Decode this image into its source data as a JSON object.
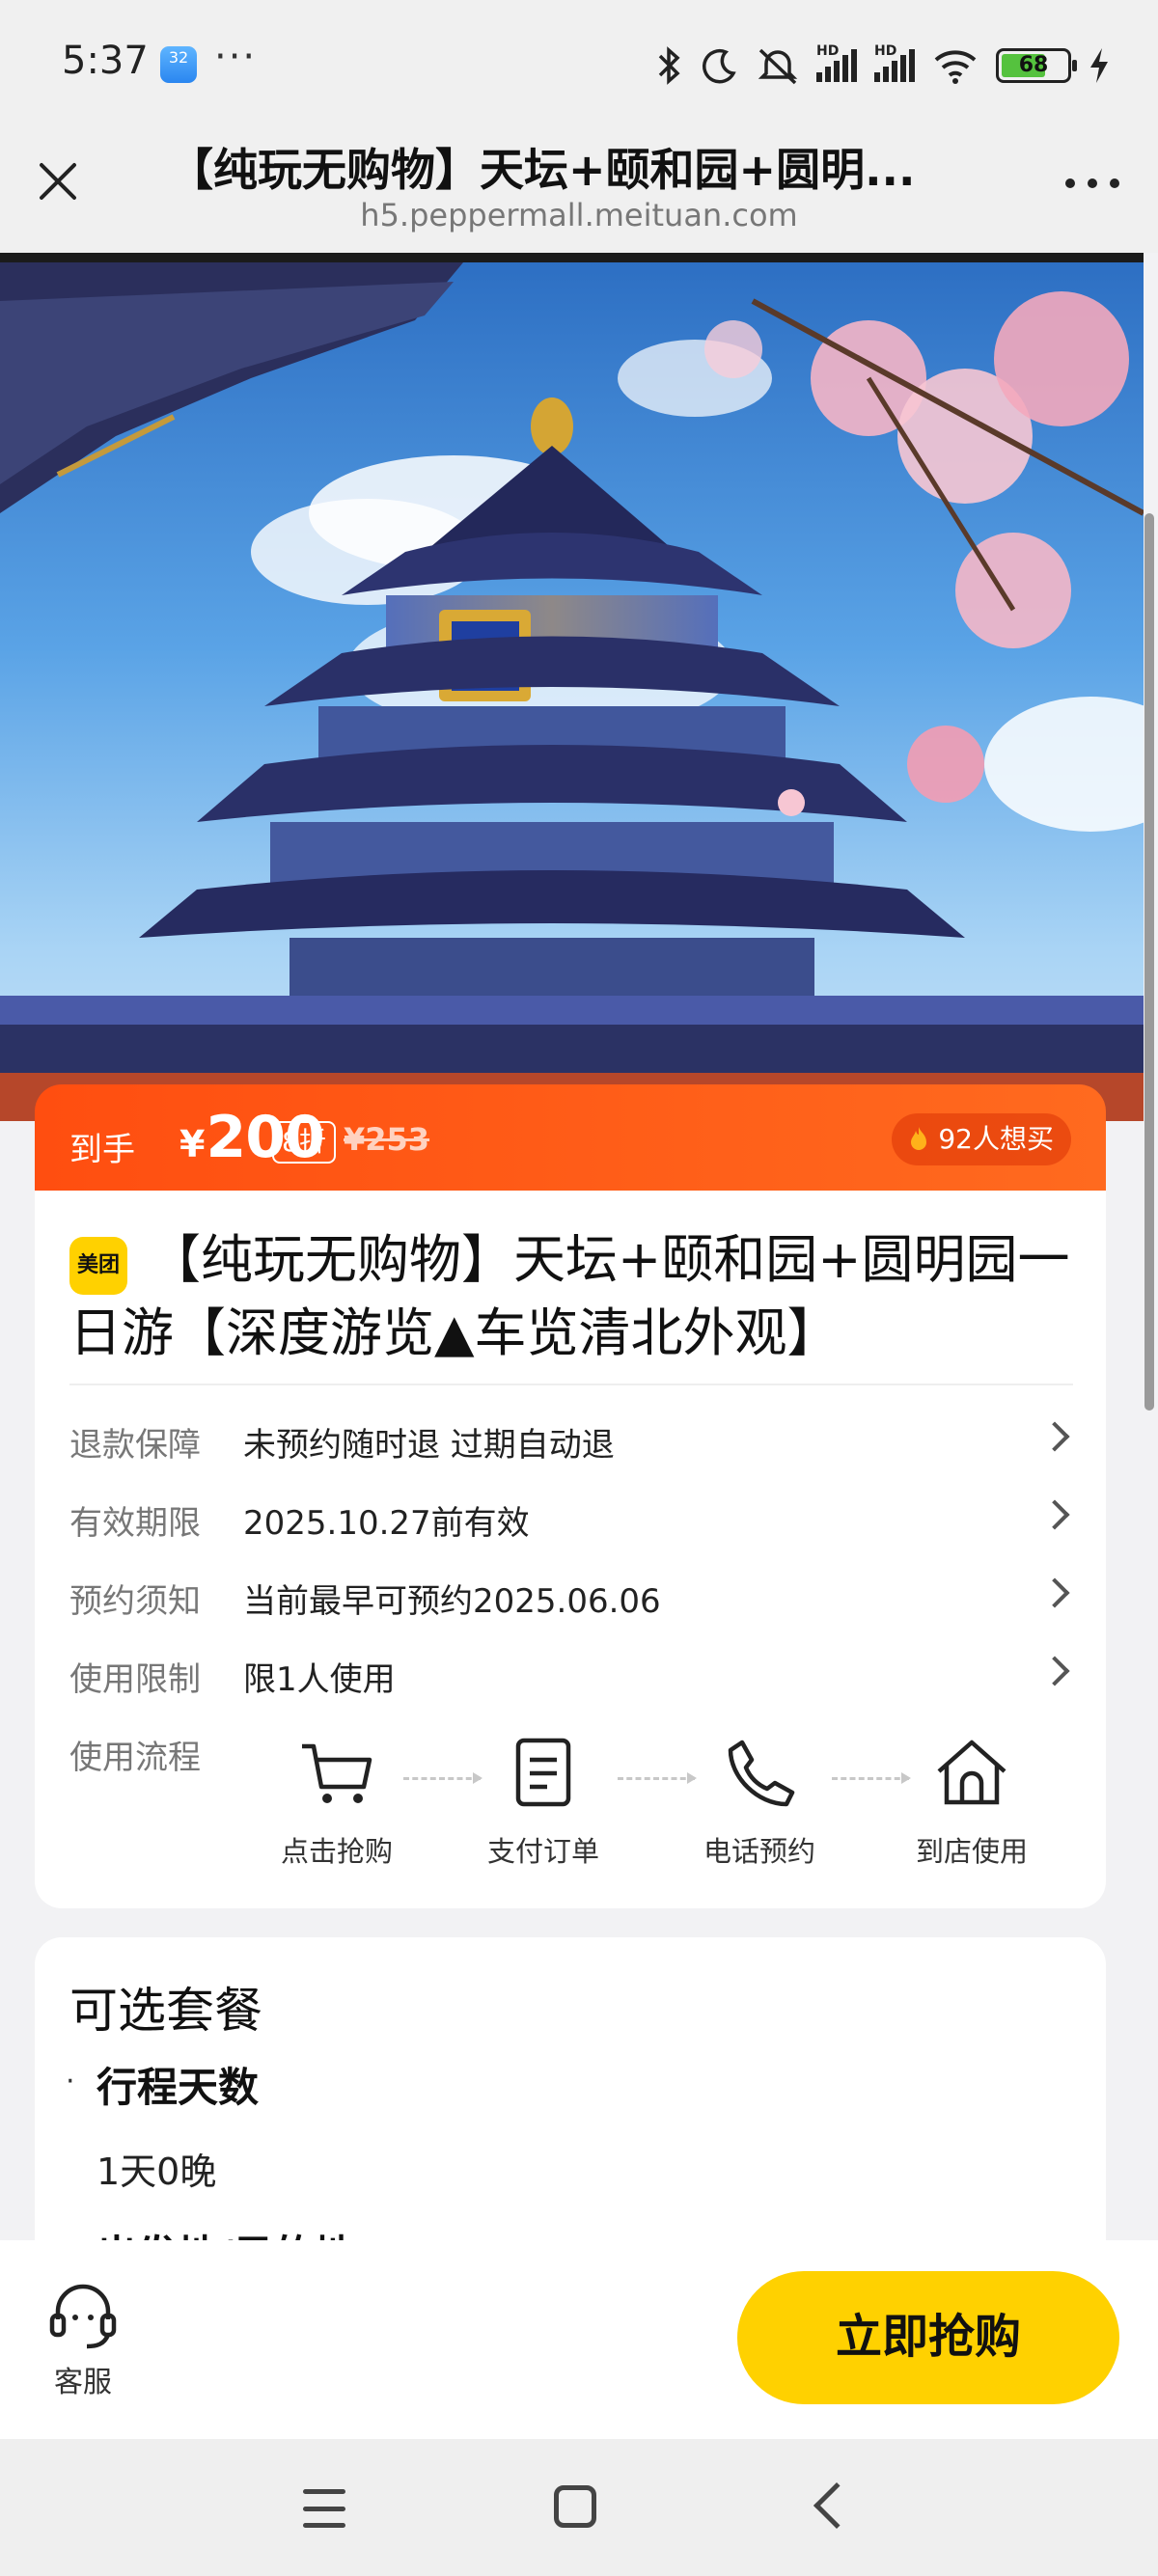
{
  "status_bar": {
    "time": "5:37",
    "app_icon_label": "32",
    "more": "···",
    "hd_label": "HD",
    "battery_level": "68",
    "icons": [
      "bluetooth-icon",
      "moon-icon",
      "mute-icon",
      "signal-icon",
      "signal-icon",
      "wifi-icon",
      "battery-icon",
      "charging-icon"
    ]
  },
  "browser": {
    "title": "【纯玩无购物】天坛+颐和园+圆明...",
    "url": "h5.peppermall.meituan.com"
  },
  "price": {
    "prefix": "到手",
    "currency": "¥",
    "amount": "200",
    "discount": "8折",
    "original": "¥253",
    "want": "92人想买"
  },
  "product": {
    "brand_logo": "美团",
    "title": "【纯玩无购物】天坛+颐和园+圆明园一日游【深度游览▲车览清北外观】",
    "rows": [
      {
        "label": "退款保障",
        "value": "未预约随时退 过期自动退"
      },
      {
        "label": "有效期限",
        "value": "2025.10.27前有效"
      },
      {
        "label": "预约须知",
        "value": "当前最早可预约2025.06.06"
      },
      {
        "label": "使用限制",
        "value": "限1人使用"
      }
    ],
    "flow_label": "使用流程",
    "flow_steps": [
      "点击抢购",
      "支付订单",
      "电话预约",
      "到店使用"
    ]
  },
  "options": {
    "title": "可选套餐",
    "bullet": "·",
    "section": "行程天数",
    "value": "1天0晚",
    "next_section_partial": "出发地/目的地"
  },
  "actions": {
    "service": "客服",
    "buy": "立即抢购"
  },
  "colors": {
    "price_bar": "#ff4e10",
    "buy_button": "#ffd100",
    "brand": "#ffd100"
  }
}
